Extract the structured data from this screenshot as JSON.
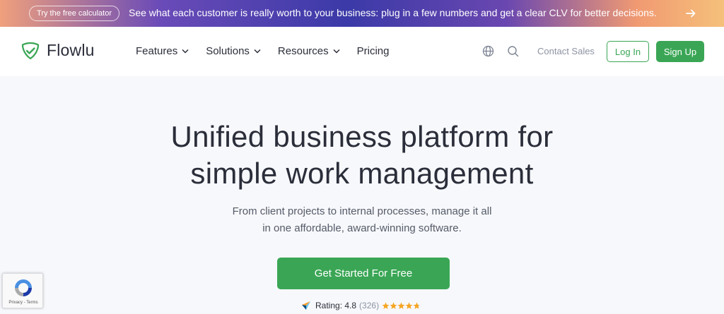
{
  "promo": {
    "pill_label": "Try the free calculator",
    "text": "See what each customer is really worth to your business: plug in a few numbers and get a clear CLV for better decisions."
  },
  "header": {
    "logo_text": "Flowlu",
    "nav": [
      {
        "label": "Features"
      },
      {
        "label": "Solutions"
      },
      {
        "label": "Resources"
      },
      {
        "label": "Pricing"
      }
    ],
    "contact_label": "Contact Sales",
    "login_label": "Log In",
    "signup_label": "Sign Up"
  },
  "hero": {
    "title_line1": "Unified business platform for",
    "title_line2": "simple work management",
    "sub_line1": "From client projects to internal processes, manage it all",
    "sub_line2": "in one affordable, award-winning software.",
    "cta_label": "Get Started For Free",
    "rating_label": "Rating: 4.8",
    "rating_count": "(326)"
  },
  "recaptcha": {
    "links": "Privacy - Terms"
  },
  "colors": {
    "accent": "#3aa655",
    "text": "#2b2e3a",
    "muted": "#8c93a3"
  }
}
